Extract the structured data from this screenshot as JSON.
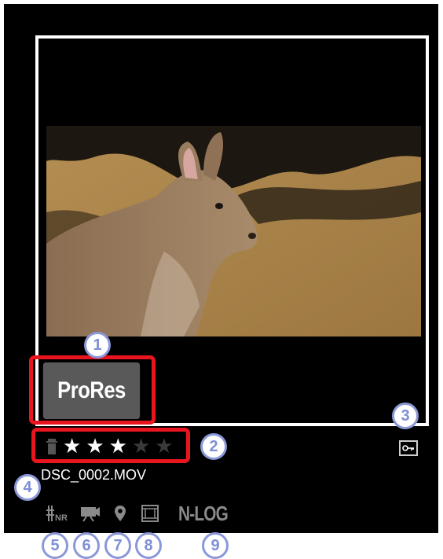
{
  "format_badge": {
    "label": "ProRes"
  },
  "rating": {
    "stars_filled": 3,
    "stars_total": 5,
    "star_glyph": "★"
  },
  "file": {
    "name": "DSC_0002.MOV"
  },
  "status_icons": {
    "nlog_label": "N-LOG",
    "icons": [
      "high-iso-nr-icon",
      "movie-camera-icon",
      "location-pin-icon",
      "frame-size-icon"
    ]
  },
  "callouts": {
    "c1": "1",
    "c2": "2",
    "c3": "3",
    "c4": "4",
    "c5": "5",
    "c6": "6",
    "c7": "7",
    "c8": "8",
    "c9": "9"
  },
  "colors": {
    "highlight": "#e8141e",
    "callout": "#8b98d8",
    "badge_bg": "#595959",
    "nlog": "#8a8a8a"
  }
}
